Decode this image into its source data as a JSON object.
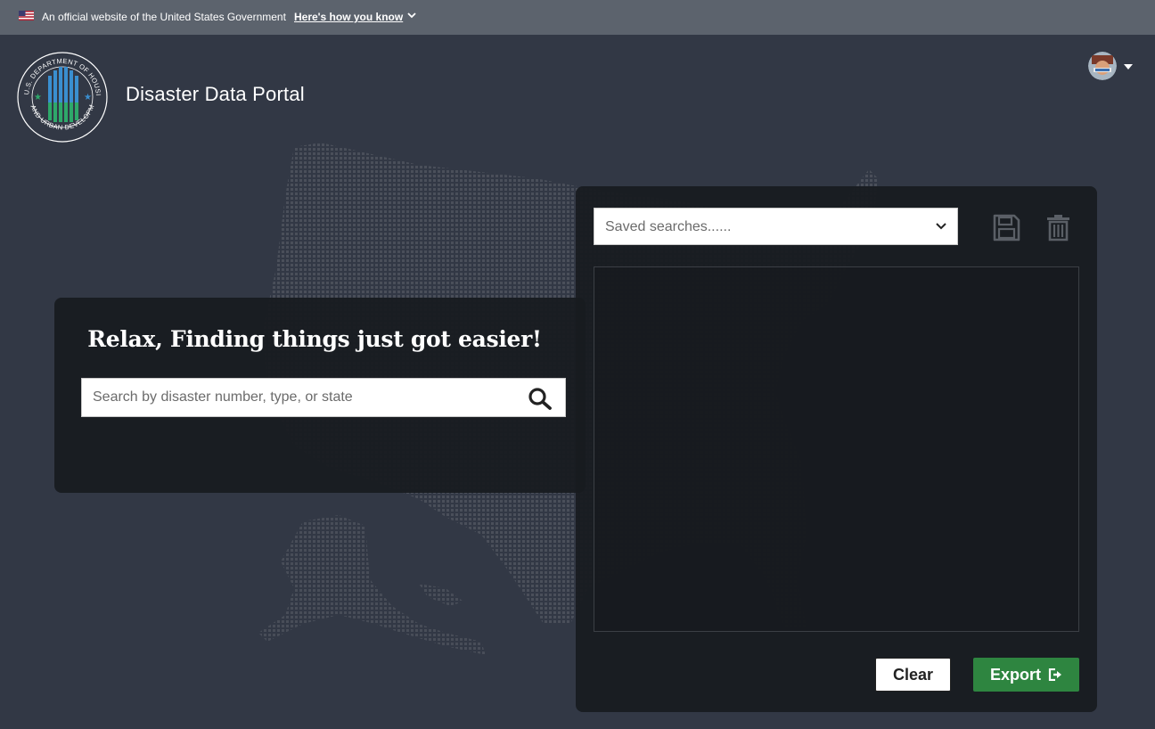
{
  "gov_banner": {
    "text": "An official website of the United States Government",
    "link_label": "Here's how you know"
  },
  "header": {
    "title": "Disaster Data Portal",
    "seal_text": "U.S. DEPARTMENT OF HOUSING AND URBAN DEVELOPMENT"
  },
  "search": {
    "tagline": "Relax, Finding things just got easier!",
    "placeholder": "Search by disaster number, type, or state"
  },
  "saved_searches": {
    "placeholder": "Saved searches......"
  },
  "actions": {
    "clear_label": "Clear",
    "export_label": "Export"
  },
  "colors": {
    "background": "#323845",
    "banner": "#5c636d",
    "panel": "#181b1f",
    "export_green": "#2e8540"
  }
}
